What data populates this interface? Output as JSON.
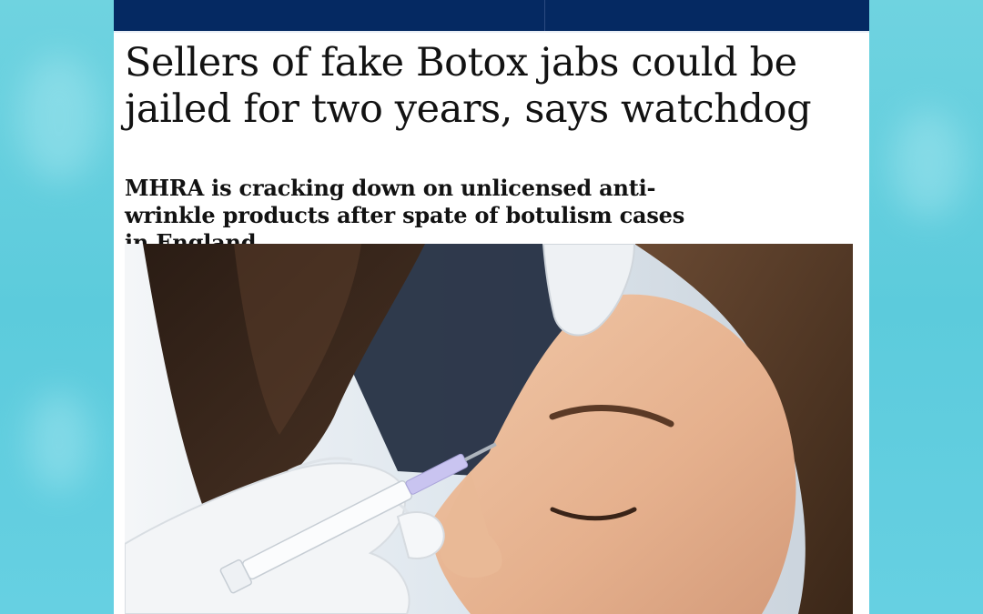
{
  "article": {
    "headline": "Sellers of fake Botox jabs could be jailed for two years, says watchdog",
    "standfirst": "MHRA is cracking down on unlicensed anti-wrinkle products after spate of botulism cases in England"
  },
  "colors": {
    "background": "#5ccbdc",
    "masthead": "#052962",
    "text": "#121212"
  },
  "image": {
    "subject": "gloved hands injecting a syringe into a woman's forehead"
  }
}
